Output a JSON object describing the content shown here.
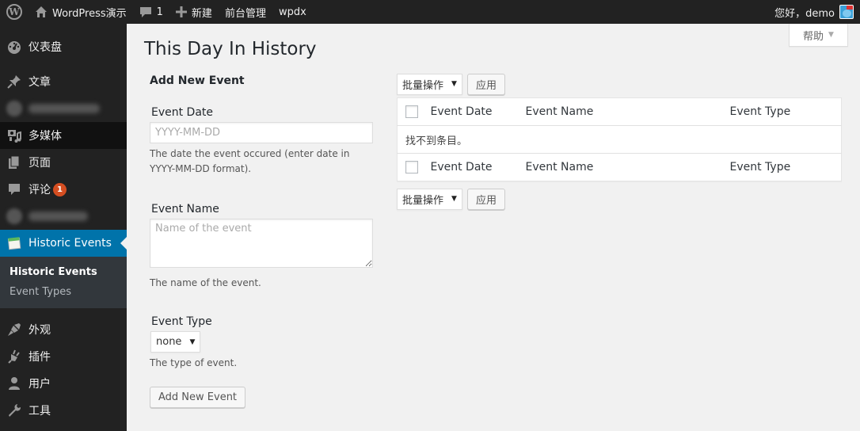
{
  "adminbar": {
    "site_name": "WordPress演示",
    "comments_count": "1",
    "new_label": "新建",
    "frontend_label": "前台管理",
    "extra_label": "wpdx",
    "greeting": "您好，demo",
    "icons": {
      "logo": "wordpress-logo-icon",
      "home": "home-icon",
      "comment": "comment-bubble-icon",
      "new": "plus-icon",
      "avatar": "user-avatar"
    }
  },
  "sidebar": {
    "items": [
      {
        "label": "仪表盘",
        "icon": "dashboard-icon"
      },
      {
        "label": "文章",
        "icon": "pushpin-icon"
      },
      {
        "label": "",
        "icon": "blurred-icon",
        "blurred": true
      },
      {
        "label": "多媒体",
        "icon": "media-icon"
      },
      {
        "label": "页面",
        "icon": "pages-icon"
      },
      {
        "label": "评论",
        "icon": "comment-icon",
        "badge": "1"
      },
      {
        "label": "",
        "icon": "blurred-icon",
        "blurred": true
      },
      {
        "label": "Historic Events",
        "icon": "calendar-icon",
        "current": true
      },
      {
        "label": "外观",
        "icon": "paintbrush-icon"
      },
      {
        "label": "插件",
        "icon": "plugin-icon"
      },
      {
        "label": "用户",
        "icon": "user-icon"
      },
      {
        "label": "工具",
        "icon": "wrench-icon"
      }
    ],
    "submenu": [
      {
        "label": "Historic Events",
        "active": true
      },
      {
        "label": "Event Types",
        "active": false
      }
    ]
  },
  "header": {
    "help_label": "帮助",
    "page_title": "This Day In History"
  },
  "form": {
    "heading": "Add New Event",
    "date_label": "Event Date",
    "date_placeholder": "YYYY-MM-DD",
    "date_value": "",
    "date_desc": "The date the event occured (enter date in YYYY-MM-DD format).",
    "name_label": "Event Name",
    "name_placeholder": "Name of the event",
    "name_value": "",
    "name_desc": "The name of the event.",
    "type_label": "Event Type",
    "type_selected": "none",
    "type_desc": "The type of event.",
    "submit_label": "Add New Event"
  },
  "list": {
    "bulk_actions_label": "批量操作",
    "apply_label": "应用",
    "columns": [
      "Event Date",
      "Event Name",
      "Event Type"
    ],
    "empty_message": "找不到条目。"
  }
}
